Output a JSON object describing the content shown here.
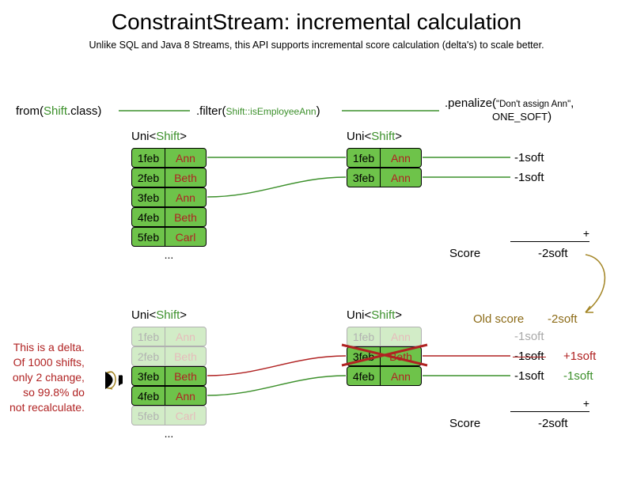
{
  "title": "ConstraintStream: incremental calculation",
  "subtitle": "Unlike SQL and Java 8 Streams, this API supports incremental score calculation (delta's) to scale better.",
  "api": {
    "from_pre": "from(",
    "from_cls": "Shift",
    "from_post": ".class)",
    "filter_pre": ".filter(",
    "filter_cls": "Shift",
    "filter_method": "::isEmployeeAnn",
    "filter_post": ")",
    "penalize_pre": ".penalize(",
    "penalize_msg": "\"Don't assign Ann\"",
    "penalize_comma": ",",
    "penalize_const": "ONE_SOFT",
    "penalize_post": ")"
  },
  "uni_label_pre": "Uni<",
  "uni_label_cls": "Shift",
  "uni_label_post": ">",
  "top": {
    "left_stack": [
      {
        "date": "1feb",
        "emp": "Ann"
      },
      {
        "date": "2feb",
        "emp": "Beth"
      },
      {
        "date": "3feb",
        "emp": "Ann"
      },
      {
        "date": "4feb",
        "emp": "Beth"
      },
      {
        "date": "5feb",
        "emp": "Carl"
      }
    ],
    "right_stack": [
      {
        "date": "1feb",
        "emp": "Ann"
      },
      {
        "date": "3feb",
        "emp": "Ann"
      }
    ],
    "penalties": [
      "-1soft",
      "-1soft"
    ],
    "dots": "...",
    "score_label": "Score",
    "score_plus": "+",
    "score_value": "-2soft"
  },
  "bottom": {
    "left_stack": [
      {
        "date": "1feb",
        "emp": "Ann",
        "faded": true
      },
      {
        "date": "2feb",
        "emp": "Beth",
        "faded": true
      },
      {
        "date": "3feb",
        "emp": "Beth",
        "faded": false
      },
      {
        "date": "4feb",
        "emp": "Ann",
        "faded": false
      },
      {
        "date": "5feb",
        "emp": "Carl",
        "faded": true
      }
    ],
    "right_stack": [
      {
        "date": "1feb",
        "emp": "Ann",
        "faded": true
      },
      {
        "date": "3feb",
        "emp": "Beth",
        "faded": false,
        "crossed": true
      },
      {
        "date": "4feb",
        "emp": "Ann",
        "faded": false
      }
    ],
    "old_score_label": "Old score",
    "old_score_value": "-2soft",
    "penalties": [
      {
        "val": "-1soft",
        "grey": true
      },
      {
        "val": "-1soft",
        "struck": true,
        "delta": "+1soft",
        "delta_color": "red"
      },
      {
        "val": "-1soft",
        "delta": "-1soft",
        "delta_color": "green"
      }
    ],
    "dots": "...",
    "score_label": "Score",
    "score_plus": "+",
    "score_value": "-2soft"
  },
  "delta_note": {
    "l1": "This is a delta.",
    "l2": "Of 1000 shifts,",
    "l3": "only 2 change,",
    "l4": "so 99.8% do",
    "l5": "not recalculate."
  }
}
